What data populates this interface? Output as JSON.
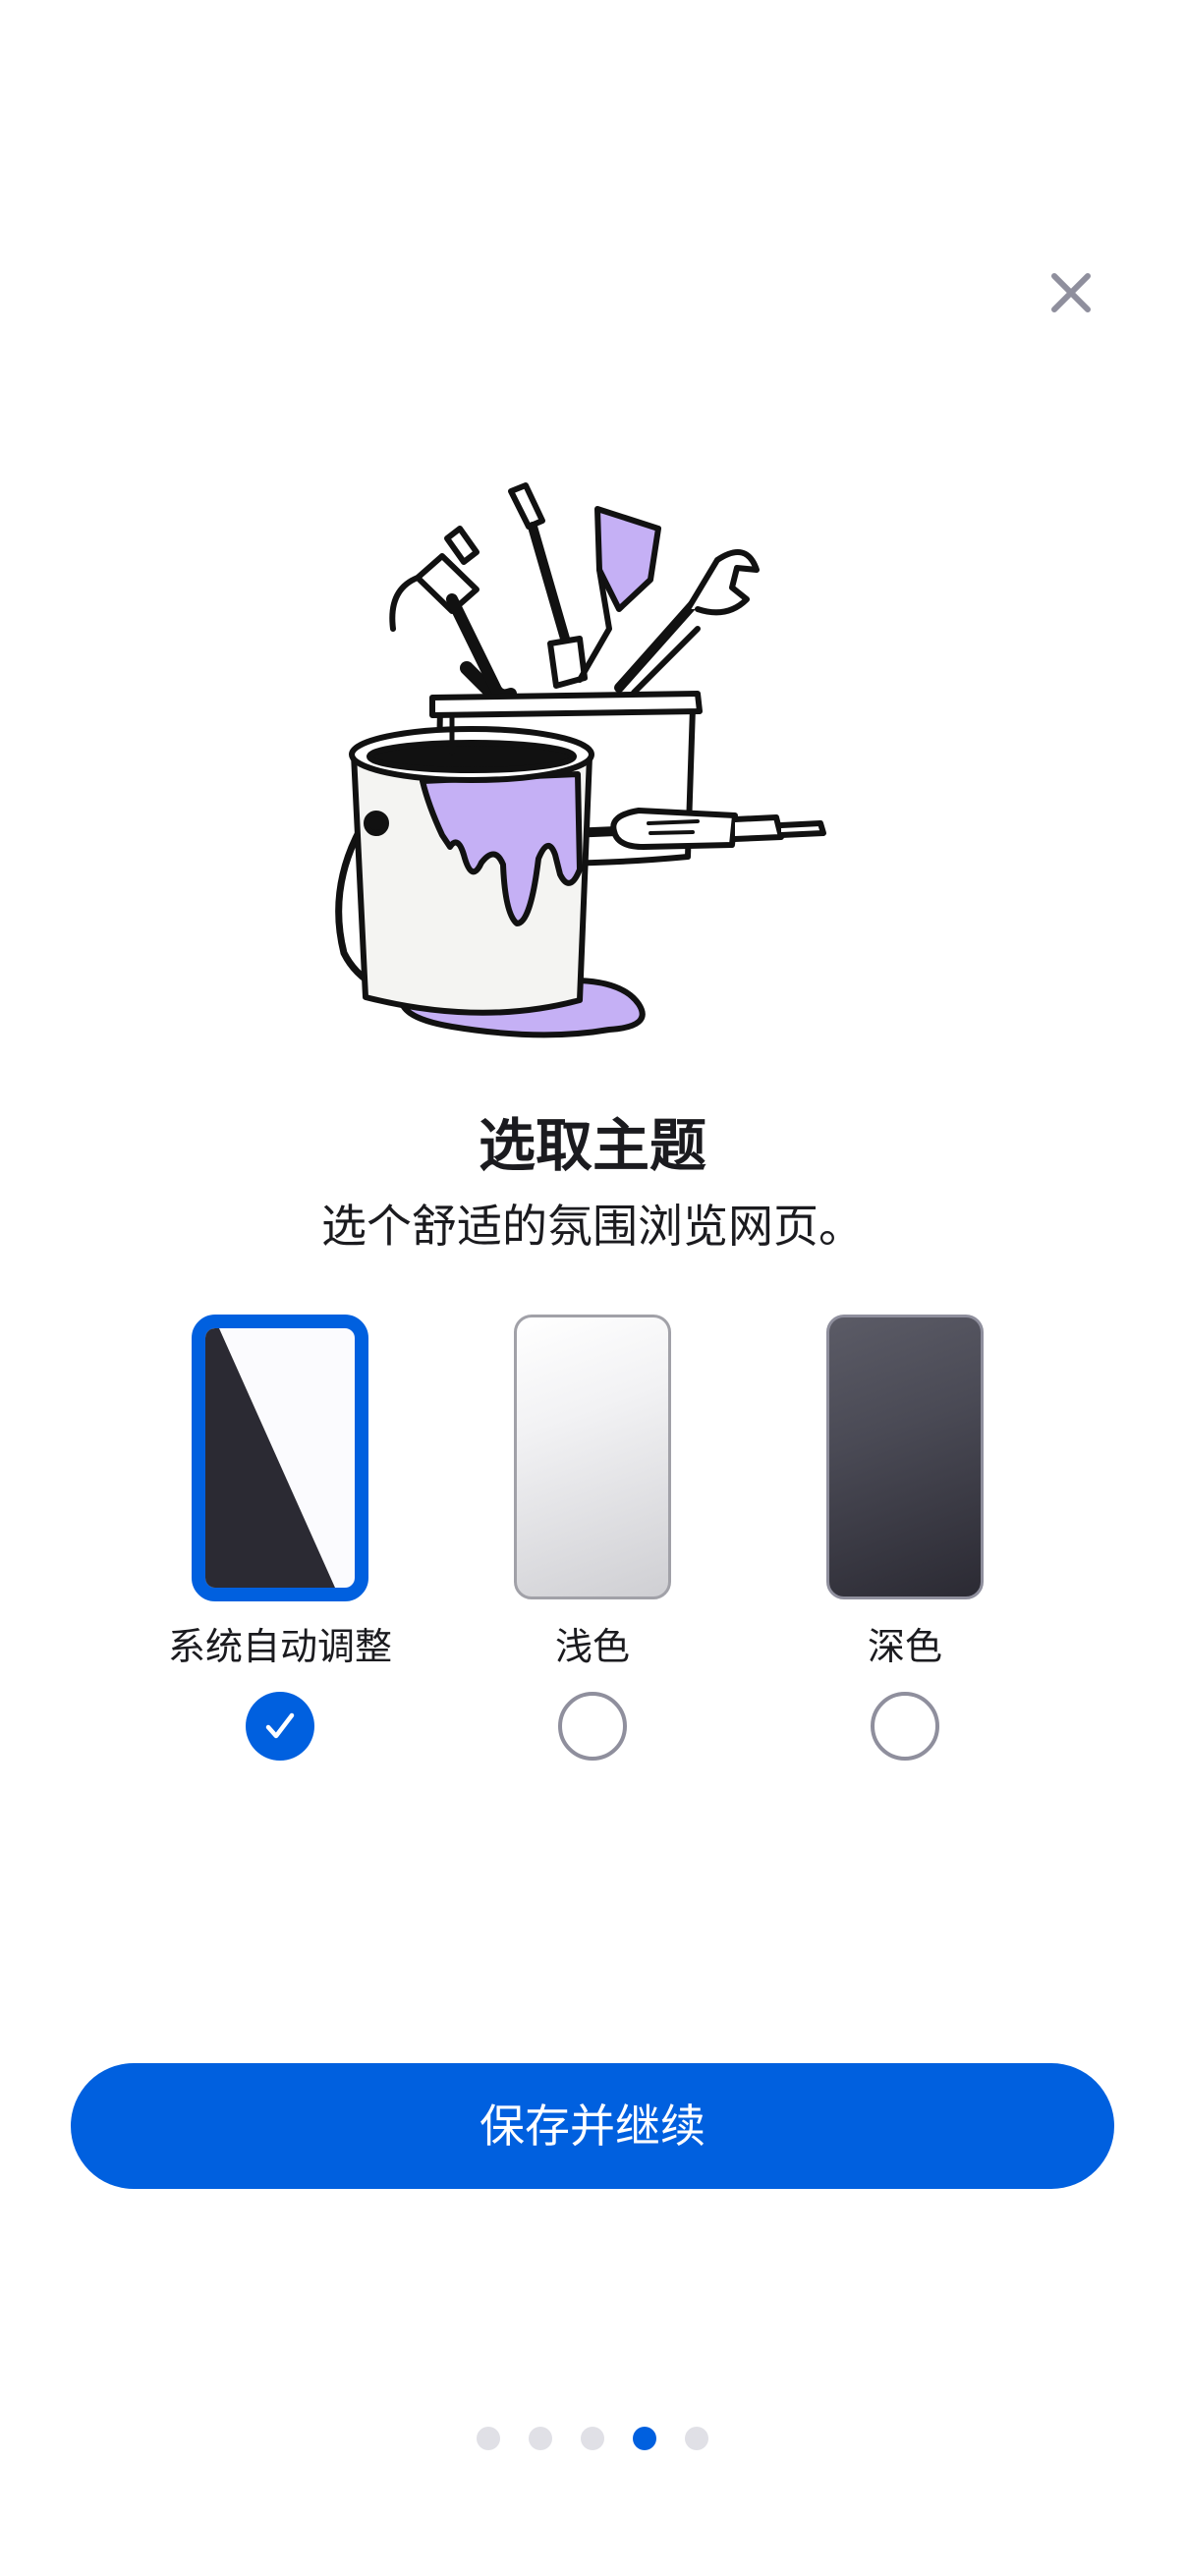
{
  "header": {
    "close_icon": "close-icon"
  },
  "illustration": {
    "name": "paint-bucket-and-toolbox-illustration",
    "accent_color": "#c5b0f5"
  },
  "content": {
    "title": "选取主题",
    "subtitle": "选个舒适的氛围浏览网页。"
  },
  "themes": [
    {
      "label": "系统自动调整",
      "selected": true
    },
    {
      "label": "浅色",
      "selected": false
    },
    {
      "label": "深色",
      "selected": false
    }
  ],
  "actions": {
    "save_label": "保存并继续"
  },
  "pager": {
    "total_pages": 5,
    "current_page": 4
  },
  "colors": {
    "accent": "#0060df",
    "text": "#1b1b1f",
    "close_icon": "#8f8f9d"
  }
}
